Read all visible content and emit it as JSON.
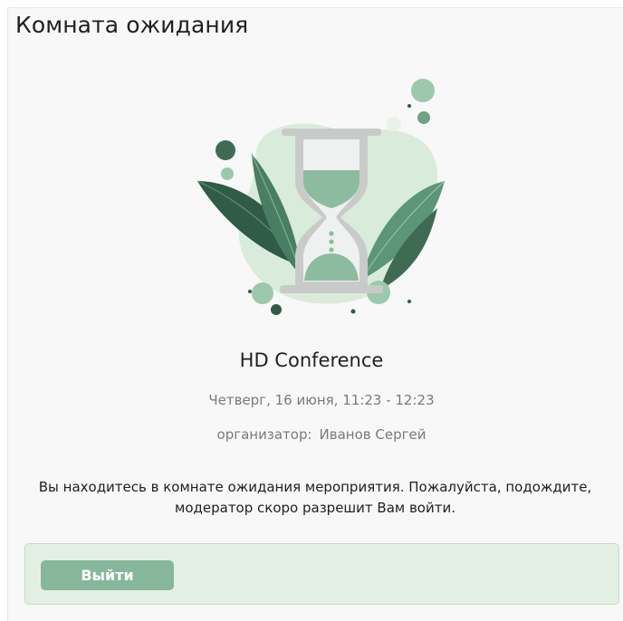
{
  "window": {
    "title": "Комната ожидания"
  },
  "event": {
    "name": "HD Conference",
    "date": "Четверг, 16 июня, 11:23 - 12:23",
    "organizer_label": "организатор:",
    "organizer_name": "Иванов Сергей"
  },
  "message": {
    "line1": "Вы находитесь в комнате ожидания мероприятия. Пожалуйста, подождите,",
    "line2": "модератор скоро разрешит Вам войти."
  },
  "footer": {
    "exit_label": "Выйти"
  },
  "colors": {
    "accent": "#86b79a",
    "footer_bg": "#e4efe3",
    "leaf_dark": "#3f6b55",
    "leaf_mid": "#6fa386",
    "blob": "#d9ecdc"
  },
  "illustration": {
    "icon": "hourglass-icon"
  }
}
